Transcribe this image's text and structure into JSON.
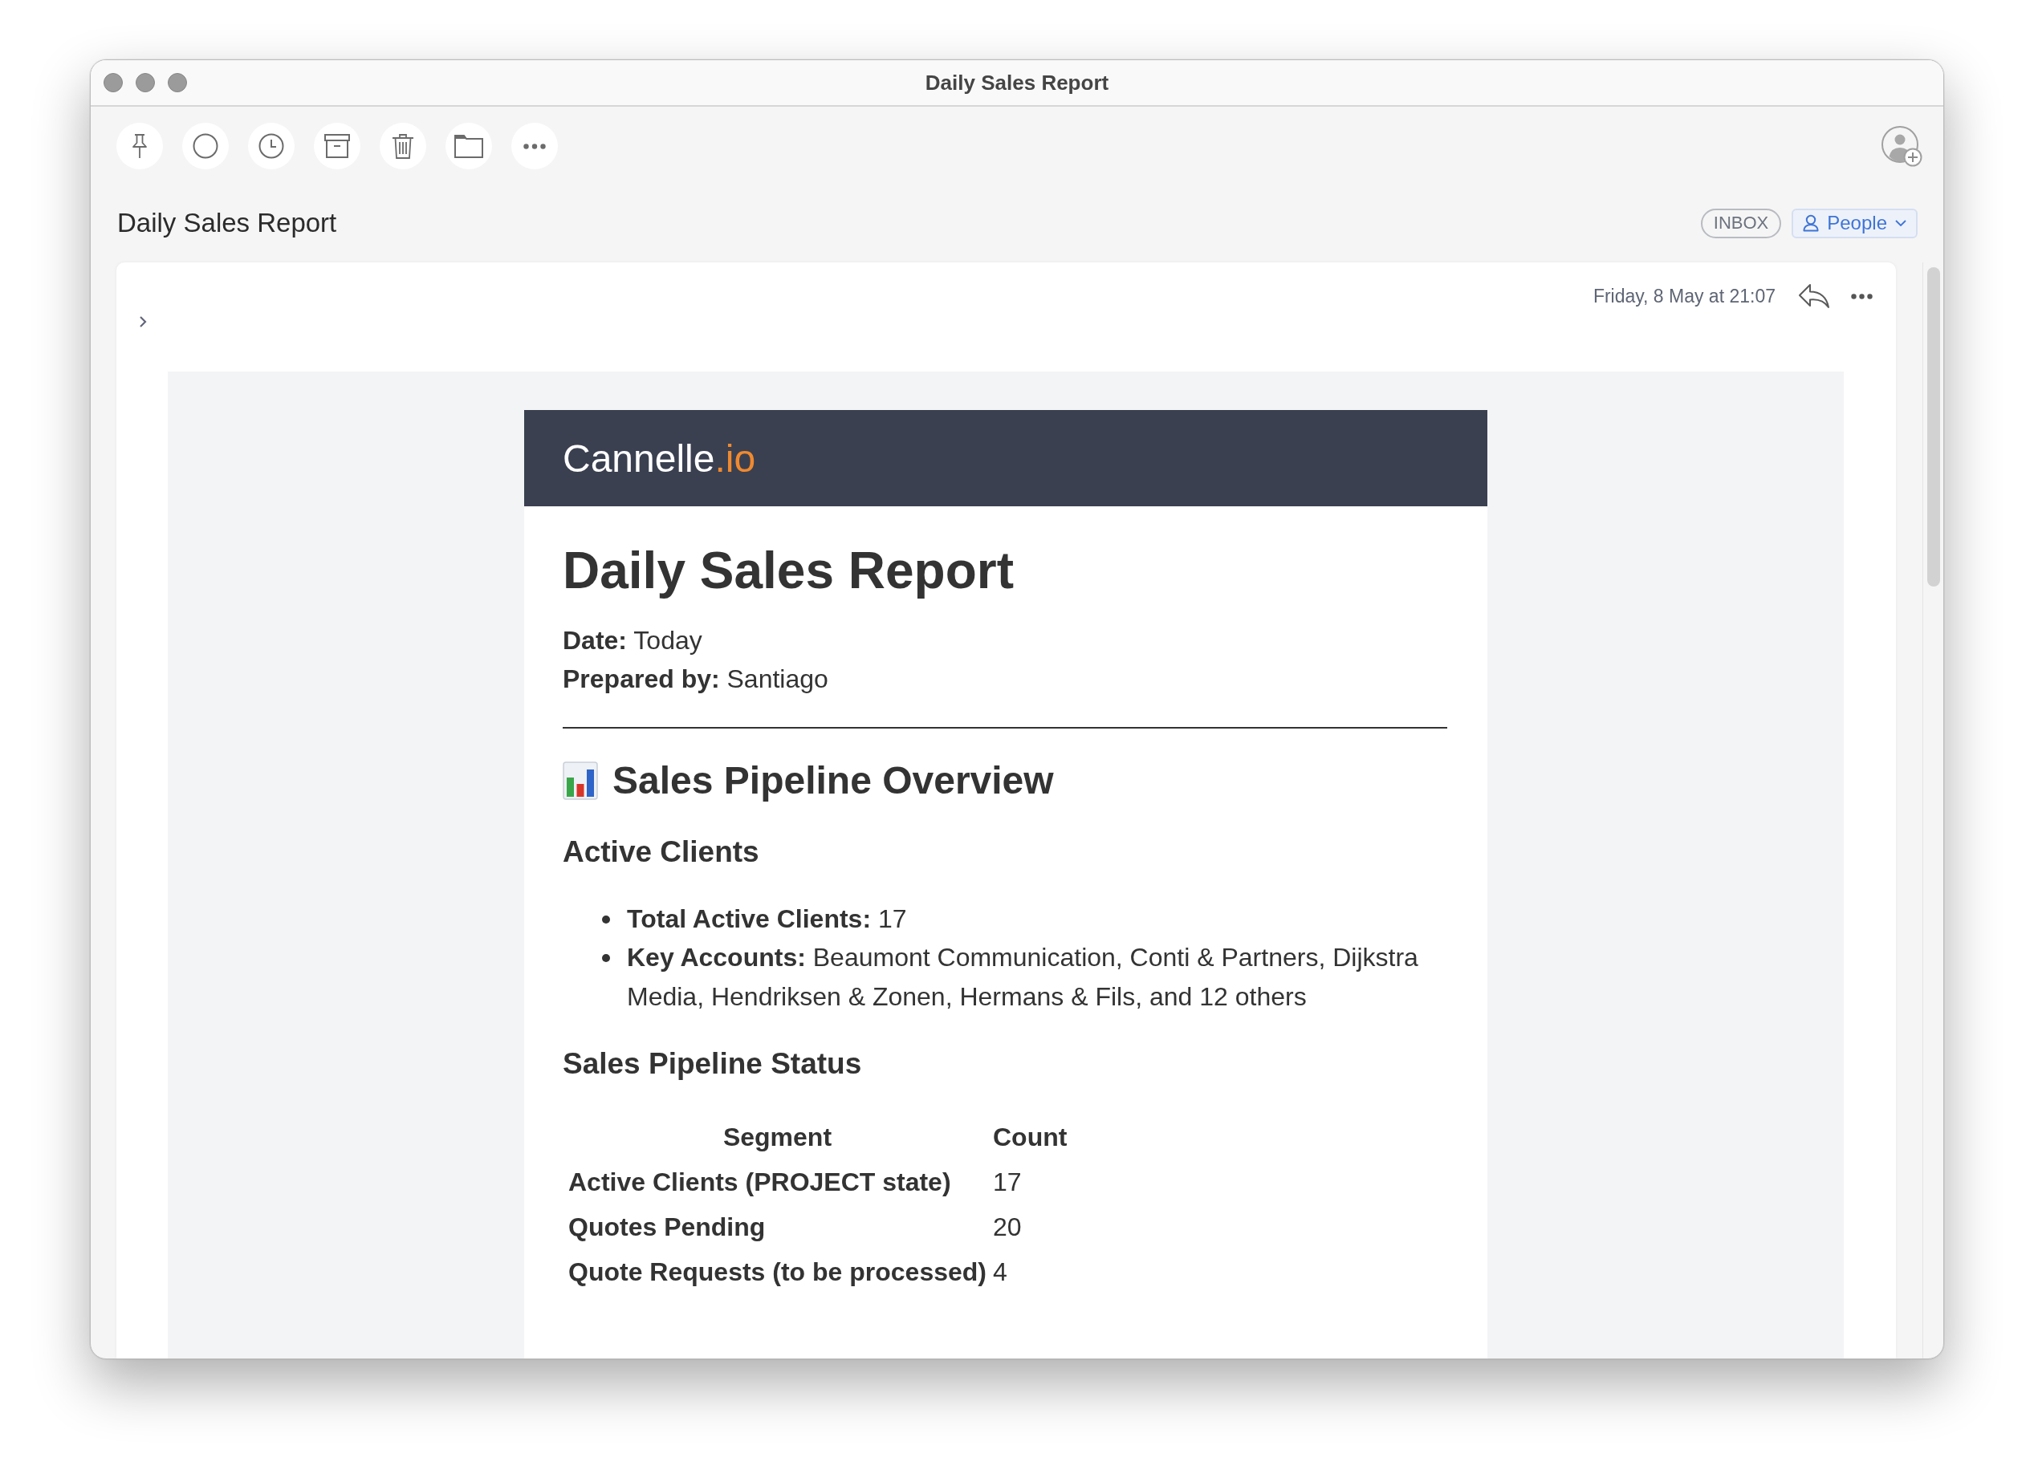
{
  "window": {
    "title": "Daily Sales Report"
  },
  "message": {
    "subject": "Daily Sales Report",
    "mailbox": "INBOX",
    "category": "People",
    "date": "Friday, 8 May at 21:07"
  },
  "email": {
    "brand": {
      "name": "Cannelle",
      "accent": ".io"
    },
    "title": "Daily Sales Report",
    "meta": [
      "**Date:** Today",
      "**Prepared by:** Santiago"
    ],
    "section_title": "Sales Pipeline Overview",
    "blocks": [
      {
        "kind": "list",
        "heading": "Active Clients",
        "items": [
          "**Total Active Clients:** 17",
          "**Key Accounts:** Beaumont Communication, Conti & Partners, Dijkstra Media, Hendriksen & Zonen, Hermans & Fils, and 12 others"
        ]
      },
      {
        "kind": "table",
        "heading": "Sales Pipeline Status",
        "columns": [
          "Segment",
          "Count"
        ],
        "rows": [
          [
            "Active Clients (PROJECT state)",
            "17"
          ],
          [
            "Quotes Pending",
            "20"
          ],
          [
            "Quote Requests (to be processed)",
            "4"
          ]
        ]
      }
    ]
  }
}
